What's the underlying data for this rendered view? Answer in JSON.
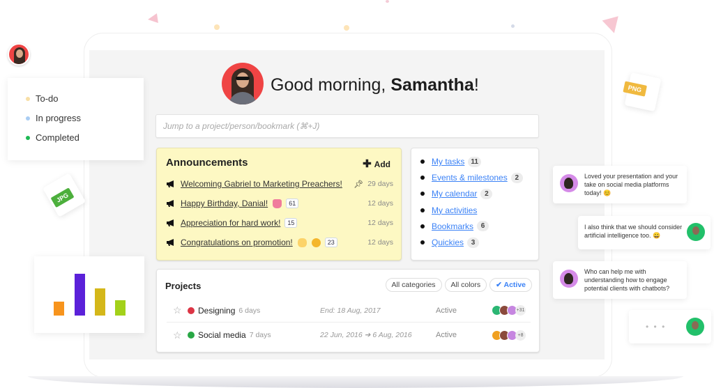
{
  "greeting": {
    "prefix": "Good morning, ",
    "name": "Samantha",
    "suffix": "!"
  },
  "search": {
    "placeholder": "Jump to a project/person/bookmark (⌘+J)"
  },
  "legend": {
    "items": [
      {
        "label": "To-do",
        "color": "#f8dfa6"
      },
      {
        "label": "In progress",
        "color": "#a9cdf3"
      },
      {
        "label": "Completed",
        "color": "#1db954"
      }
    ]
  },
  "files": {
    "jpg": "JPG",
    "png": "PNG"
  },
  "mini_chart": {
    "bars": [
      {
        "value": 0.33,
        "color": "#f7941d"
      },
      {
        "value": 1.0,
        "color": "#5b21d9"
      },
      {
        "value": 0.65,
        "color": "#d4b71a"
      },
      {
        "value": 0.36,
        "color": "#a3d11a"
      }
    ]
  },
  "announcements": {
    "title": "Announcements",
    "add_label": "Add",
    "items": [
      {
        "text": "Welcoming Gabriel to Marketing Preachers!",
        "emojis": [],
        "count": null,
        "pinned": true,
        "age": "29 days"
      },
      {
        "text": "Happy Birthday, Danial!",
        "emojis": [
          "cake"
        ],
        "count": "61",
        "pinned": false,
        "age": "12 days"
      },
      {
        "text": "Appreciation for hard work!",
        "emojis": [],
        "count": "15",
        "pinned": false,
        "age": "12 days"
      },
      {
        "text": "Congratulations on promotion!",
        "emojis": [
          "clap",
          "grin"
        ],
        "count": "23",
        "pinned": false,
        "age": "12 days"
      }
    ]
  },
  "quick_links": [
    {
      "label": "My tasks",
      "count": "11"
    },
    {
      "label": "Events & milestones",
      "count": "2"
    },
    {
      "label": "My calendar",
      "count": "2"
    },
    {
      "label": "My activities",
      "count": null
    },
    {
      "label": "Bookmarks",
      "count": "6"
    },
    {
      "label": "Quickies",
      "count": "3"
    }
  ],
  "projects": {
    "title": "Projects",
    "filters": [
      {
        "label": "All categories",
        "active": false
      },
      {
        "label": "All colors",
        "active": false
      },
      {
        "label": "✔ Active",
        "active": true
      }
    ],
    "rows": [
      {
        "name": "Designing",
        "duration": "6 days",
        "dates": "End: 18 Aug, 2017",
        "status": "Active",
        "color": "#dc3545",
        "more_members": "+31",
        "avatar_colors": [
          "#2bb673",
          "#8b4a3c",
          "#c686e0"
        ]
      },
      {
        "name": "Social media",
        "duration": "7 days",
        "dates": "22 Jun, 2016 ➔ 6 Aug, 2016",
        "status": "Active",
        "color": "#28a745",
        "more_members": "+8",
        "avatar_colors": [
          "#f0a020",
          "#8b4a3c",
          "#c686e0"
        ]
      }
    ]
  },
  "chat": [
    {
      "text": "Loved your presentation and your take on social media platforms today! 😊",
      "side": "left"
    },
    {
      "text": "I also think that we should consider artificial intelligence too. 😀",
      "side": "right"
    },
    {
      "text": "Who can help me with understanding how to engage potential clients with chatbots?",
      "side": "left"
    },
    {
      "text": "• • •",
      "side": "right"
    }
  ]
}
